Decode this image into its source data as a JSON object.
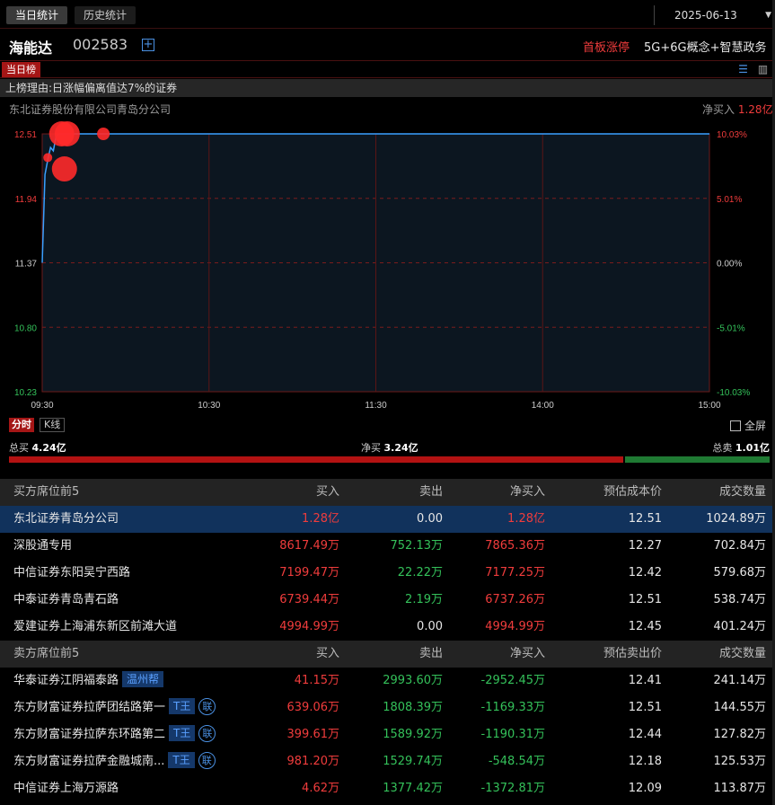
{
  "tabs": {
    "today": "当日统计",
    "history": "历史统计"
  },
  "date": "2025-06-13",
  "stock": {
    "name": "海能达",
    "code": "002583",
    "limit_tag": "首板涨停",
    "concepts": "5G+6G概念+智慧政务"
  },
  "list": {
    "tag": "当日榜",
    "reason": "上榜理由:日涨幅偏离值达7%的证券"
  },
  "branch": {
    "title": "东北证券股份有限公司青岛分公司",
    "net_buy_label": "净买入",
    "net_buy_value": "1.28亿"
  },
  "chart_data": {
    "type": "line",
    "x_ticks": [
      "09:30",
      "10:30",
      "11:30",
      "14:00",
      "15:00"
    ],
    "y_ticks_left": [
      "12.51",
      "11.94",
      "11.37",
      "10.80",
      "10.23"
    ],
    "y_ticks_right": [
      "10.03%",
      "5.01%",
      "0.00%",
      "-5.01%",
      "-10.03%"
    ],
    "ylim": [
      10.23,
      12.51
    ],
    "series": [
      {
        "x": [
          "09:30",
          "09:31",
          "09:32",
          "09:33",
          "09:34",
          "09:35",
          "09:36",
          "09:37",
          "09:38",
          "09:39",
          "09:40",
          "10:30",
          "11:30",
          "13:01",
          "14:00",
          "15:00"
        ],
        "values": [
          11.37,
          12.15,
          12.28,
          12.39,
          12.36,
          12.49,
          12.51,
          12.51,
          12.51,
          12.51,
          12.51,
          12.51,
          12.51,
          12.51,
          12.51,
          12.51
        ]
      }
    ],
    "markers": [
      {
        "x": "09:32",
        "y": 12.3,
        "size": "small"
      },
      {
        "x": "09:37",
        "y": 12.51,
        "size": "large"
      },
      {
        "x": "09:38",
        "y": 12.2,
        "size": "large"
      },
      {
        "x": "09:39",
        "y": 12.51,
        "size": "large"
      },
      {
        "x": "09:52",
        "y": 12.51,
        "size": "medium"
      }
    ]
  },
  "timeframe": {
    "intraday": "分时",
    "kline": "K线",
    "fullscreen": "全屏"
  },
  "totals": {
    "buy_label": "总买",
    "buy_value": "4.24亿",
    "net_label": "净买",
    "net_value": "3.24亿",
    "sell_label": "总卖",
    "sell_value": "1.01亿",
    "buy_ratio": 0.807
  },
  "buy_table": {
    "headers": [
      "买方席位前5",
      "买入",
      "卖出",
      "净买入",
      "预估成本价",
      "成交数量"
    ],
    "rows": [
      {
        "name": "东北证券青岛分公司",
        "buy": "1.28亿",
        "sell": "0.00",
        "net": "1.28亿",
        "price": "12.51",
        "vol": "1024.89万"
      },
      {
        "name": "深股通专用",
        "buy": "8617.49万",
        "sell": "752.13万",
        "net": "7865.36万",
        "price": "12.27",
        "vol": "702.84万"
      },
      {
        "name": "中信证券东阳吴宁西路",
        "buy": "7199.47万",
        "sell": "22.22万",
        "net": "7177.25万",
        "price": "12.42",
        "vol": "579.68万"
      },
      {
        "name": "中泰证券青岛青石路",
        "buy": "6739.44万",
        "sell": "2.19万",
        "net": "6737.26万",
        "price": "12.51",
        "vol": "538.74万"
      },
      {
        "name": "爱建证券上海浦东新区前滩大道",
        "buy": "4994.99万",
        "sell": "0.00",
        "net": "4994.99万",
        "price": "12.45",
        "vol": "401.24万"
      }
    ]
  },
  "sell_table": {
    "headers": [
      "卖方席位前5",
      "买入",
      "卖出",
      "净买入",
      "预估卖出价",
      "成交数量"
    ],
    "rows": [
      {
        "name": "华泰证券江阴福泰路",
        "badge": "温州帮",
        "buy": "41.15万",
        "sell": "2993.60万",
        "net": "-2952.45万",
        "price": "12.41",
        "vol": "241.14万"
      },
      {
        "name": "东方财富证券拉萨团结路第一",
        "badge": "T王",
        "lian": "联",
        "buy": "639.06万",
        "sell": "1808.39万",
        "net": "-1169.33万",
        "price": "12.51",
        "vol": "144.55万"
      },
      {
        "name": "东方财富证券拉萨东环路第二",
        "badge": "T王",
        "lian": "联",
        "buy": "399.61万",
        "sell": "1589.92万",
        "net": "-1190.31万",
        "price": "12.44",
        "vol": "127.82万"
      },
      {
        "name": "东方财富证券拉萨金融城南...",
        "badge": "T王",
        "lian": "联",
        "buy": "981.20万",
        "sell": "1529.74万",
        "net": "-548.54万",
        "price": "12.18",
        "vol": "125.53万"
      },
      {
        "name": "中信证券上海万源路",
        "buy": "4.62万",
        "sell": "1377.42万",
        "net": "-1372.81万",
        "price": "12.09",
        "vol": "113.87万"
      }
    ]
  }
}
